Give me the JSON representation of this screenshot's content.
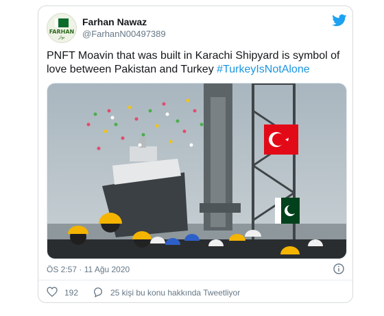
{
  "tweet": {
    "author_name": "Farhan Nawaz",
    "handle": "@FarhanN00497389",
    "avatar_text": "FARHAN",
    "avatar_subtext": "نواز",
    "text": "PNFT Moavin that was built in Karachi Shipyard is symbol of love between Pakistan and Turkey ",
    "hashtag": "#TurkeyIsNotAlone",
    "timestamp": "ÖS 2:57 · 11 Ağu 2020",
    "like_count": "192",
    "talking_text": "25 kişi bu konu hakkında Tweetliyor"
  },
  "colors": {
    "accent": "#1b95e0",
    "muted": "#657786",
    "heart": "#657786"
  },
  "icons": {
    "brand": "twitter-bird-icon",
    "info": "info-icon",
    "like": "heart-icon",
    "conversation": "chat-bubble-icon"
  }
}
